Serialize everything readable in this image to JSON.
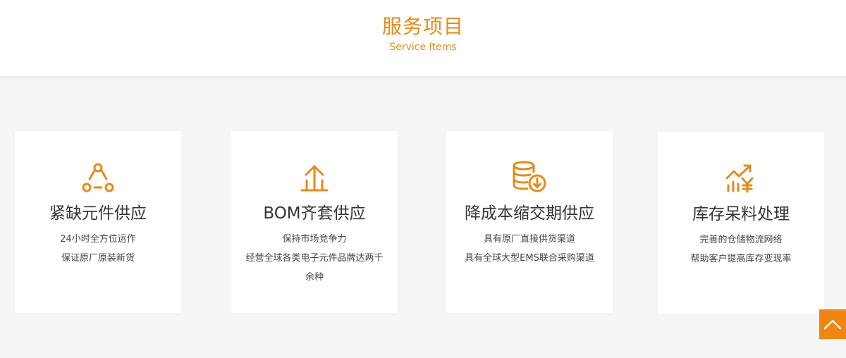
{
  "header": {
    "title": "服务项目",
    "subtitle": "Service Items"
  },
  "colors": {
    "accent": "#e88a14",
    "back_to_top_bg": "#f08512",
    "page_bg": "#f5f5f5",
    "card_bg": "#ffffff"
  },
  "cards": [
    {
      "icon": "network-nodes-icon",
      "title": "紧缺元件供应",
      "lines": [
        "24小时全方位运作",
        "保证原厂原装新货"
      ]
    },
    {
      "icon": "upload-arrow-icon",
      "title": "BOM齐套供应",
      "lines": [
        "保持市场竞争力",
        "经营全球各类电子元件品牌达两千",
        "余种"
      ]
    },
    {
      "icon": "coin-stack-down-icon",
      "title": "降成本缩交期供应",
      "lines": [
        "具有原厂直接供货渠道",
        "具有全球大型EMS联合采购渠道"
      ]
    },
    {
      "icon": "chart-yen-icon",
      "title": "库存呆料处理",
      "lines": [
        "完善的仓储物流网络",
        "帮助客户提高库存变现率"
      ]
    }
  ],
  "back_to_top": {
    "icon": "chevron-up-icon"
  }
}
